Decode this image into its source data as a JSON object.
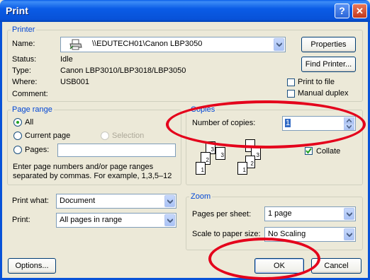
{
  "window": {
    "title": "Print"
  },
  "printer": {
    "group_label": "Printer",
    "name_label": "Name:",
    "name_value": "\\\\EDUTECH01\\Canon LBP3050",
    "properties_button": "Properties",
    "find_printer_button": "Find Printer...",
    "status_label": "Status:",
    "status_value": "Idle",
    "type_label": "Type:",
    "type_value": "Canon LBP3010/LBP3018/LBP3050",
    "where_label": "Where:",
    "where_value": "USB001",
    "comment_label": "Comment:",
    "print_to_file_label": "Print to file",
    "manual_duplex_label": "Manual duplex"
  },
  "page_range": {
    "group_label": "Page range",
    "all_label": "All",
    "current_page_label": "Current page",
    "selection_label": "Selection",
    "pages_label": "Pages:",
    "help_line1": "Enter page numbers and/or page ranges",
    "help_line2": "separated by commas.  For example, 1,3,5–12"
  },
  "copies": {
    "group_label": "Copies",
    "number_label": "Number of copies:",
    "number_value": "1",
    "collate_label": "Collate",
    "collate_checked": true,
    "page_numbers": [
      "3",
      "2",
      "1"
    ]
  },
  "print_what": {
    "label": "Print what:",
    "value": "Document"
  },
  "print": {
    "label": "Print:",
    "value": "All pages in range"
  },
  "zoom": {
    "group_label": "Zoom",
    "pages_per_sheet_label": "Pages per sheet:",
    "pages_per_sheet_value": "1 page",
    "scale_label": "Scale to paper size:",
    "scale_value": "No Scaling"
  },
  "footer": {
    "options_button": "Options...",
    "ok_button": "OK",
    "cancel_button": "Cancel"
  },
  "colors": {
    "title_bar": "#0852d8",
    "dialog_bg": "#ece9d8",
    "group_label": "#0046d5",
    "annotation": "#e4001b"
  },
  "icons": {
    "printer": "printer-icon",
    "help": "help-icon",
    "close": "close-icon"
  }
}
